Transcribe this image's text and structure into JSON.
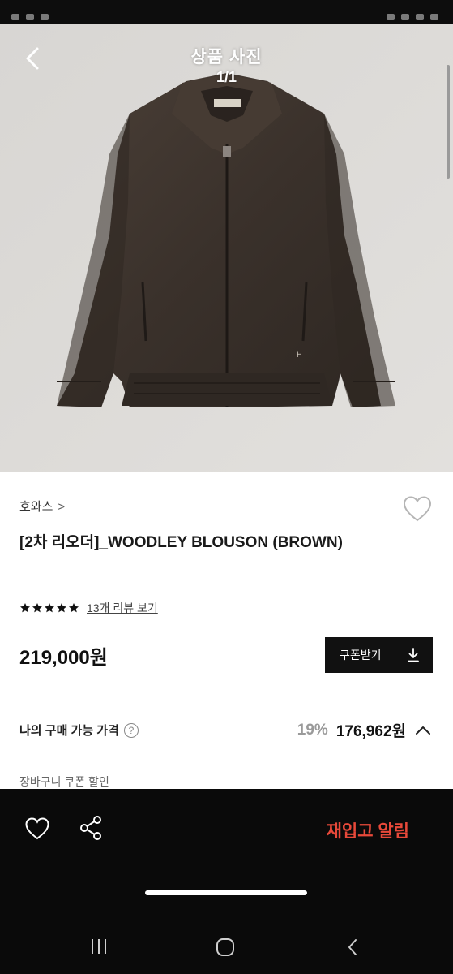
{
  "header": {
    "title": "상품 사진",
    "counter": "1/1"
  },
  "product": {
    "brand": "호와스",
    "brand_chevron": ">",
    "name": "[2차 리오더]_WOODLEY BLOUSON (BROWN)",
    "rating_stars": 5,
    "review_link": "13개 리뷰 보기",
    "price": "219,000원",
    "jacket_color": "#3b322c"
  },
  "coupon": {
    "label": "쿠폰받기",
    "icon": "download-icon"
  },
  "my_price": {
    "label": "나의 구매 가능 가격",
    "help": "?",
    "discount": "19%",
    "final_price": "176,962원"
  },
  "cart_coupon": {
    "label": "장바구니 쿠폰 할인"
  },
  "bottom_bar": {
    "restock_label": "재입고 알림",
    "restock_color": "#e8493a",
    "icons": [
      "heart-icon",
      "share-icon"
    ]
  },
  "system_nav": {
    "icons": [
      "recent-apps-icon",
      "home-icon",
      "back-icon"
    ]
  }
}
